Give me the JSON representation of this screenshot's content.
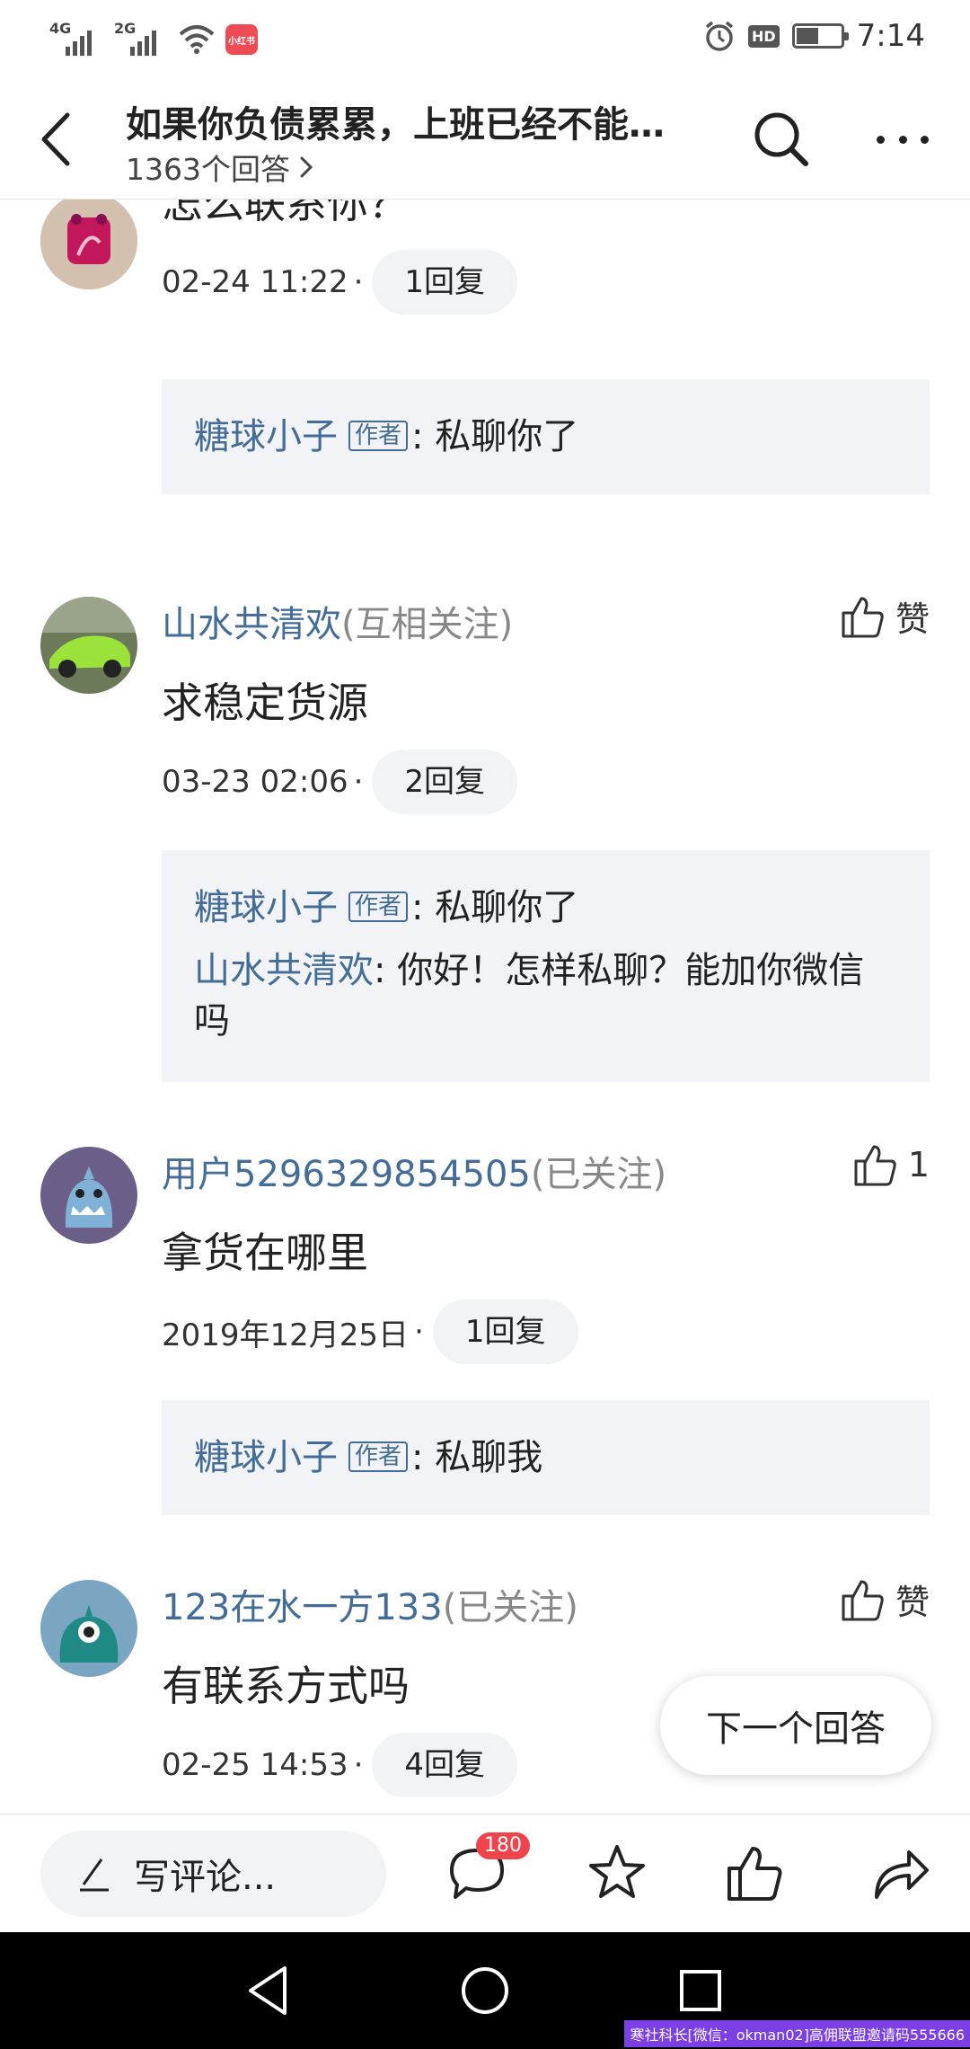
{
  "status_bar": {
    "network1": "4G",
    "network2": "2G",
    "app_badge": "小红书",
    "hd": "HD",
    "time": "7:14"
  },
  "nav": {
    "title": "如果你负债累累，上班已经不能…",
    "answer_count": "1363个回答"
  },
  "comments": [
    {
      "text": "怎么联系你？",
      "time": "02-24 11:22",
      "reply_count": "1回复",
      "replies": [
        {
          "user": "糖球小子",
          "tag": "作者",
          "text": ": 私聊你了"
        }
      ]
    },
    {
      "user": "山水共清欢",
      "relation": "(互相关注)",
      "like": "赞",
      "text": "求稳定货源",
      "time": "03-23 02:06",
      "reply_count": "2回复",
      "replies": [
        {
          "user": "糖球小子",
          "tag": "作者",
          "text": ": 私聊你了"
        },
        {
          "user": "山水共清欢",
          "text": ": 你好！怎样私聊？能加你微信吗"
        }
      ]
    },
    {
      "user": "用户5296329854505",
      "relation": "(已关注)",
      "like": "1",
      "text": "拿货在哪里",
      "time": "2019年12月25日",
      "reply_count": "1回复",
      "replies": [
        {
          "user": "糖球小子",
          "tag": "作者",
          "text": ": 私聊我"
        }
      ]
    },
    {
      "user": "123在水一方133",
      "relation": "(已关注)",
      "like": "赞",
      "text": "有联系方式吗",
      "time": "02-25 14:53",
      "reply_count": "4回复"
    }
  ],
  "meta_separator": "·",
  "next_answer": "下一个回答",
  "bottom_bar": {
    "write_placeholder": "写评论...",
    "comment_badge": "180"
  },
  "watermark": "寒社科长[微信：okman02]高佣联盟邀请码555666",
  "icons": {
    "back": "back-arrow-icon",
    "search": "search-icon",
    "more": "more-icon",
    "like": "thumbs-up-icon",
    "pen": "pen-icon",
    "comment": "comment-icon",
    "star": "star-icon",
    "share": "share-icon"
  },
  "colors": {
    "link_blue": "#436c97",
    "reply_bg": "#f1f3f6",
    "badge_red": "#f0444c"
  }
}
